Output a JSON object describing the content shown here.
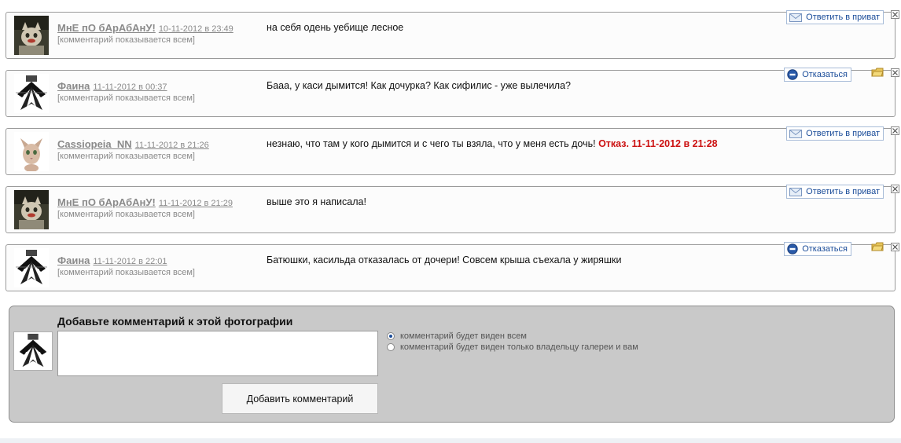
{
  "comments": [
    {
      "author": "МнЕ пО бАрАбАнУ!",
      "date": "10-11-2012 в 23:49",
      "visibility": "[комментарий показывается всем]",
      "text": "на себя одень уебище лесное",
      "refusal": "",
      "action": "Ответить в приват",
      "action_icon": "envelope-icon",
      "avatar": "cat-avatar"
    },
    {
      "author": "Фаина",
      "date": "11-11-2012 в 00:37",
      "visibility": "[комментарий показывается всем]",
      "text": "Бааа, у каси дымится! Как дочурка? Как сифилис - уже вылечила?",
      "refusal": "",
      "action": "Отказаться",
      "action_icon": "minus-circle-icon",
      "avatar": "bw-drawing-avatar"
    },
    {
      "author": "Cassiopeia_NN",
      "date": "11-11-2012 в 21:26",
      "visibility": "[комментарий показывается всем]",
      "text": "незнаю, что там у кого дымится и с чего ты взяла, что у меня есть дочь!",
      "refusal": "Отказ. 11-11-2012 в 21:28",
      "action": "Ответить в приват",
      "action_icon": "envelope-icon",
      "avatar": "sphynx-cat-avatar"
    },
    {
      "author": "МнЕ пО бАрАбАнУ!",
      "date": "11-11-2012 в 21:29",
      "visibility": "[комментарий показывается всем]",
      "text": "выше это я написала!",
      "refusal": "",
      "action": "Ответить в приват",
      "action_icon": "envelope-icon",
      "avatar": "cat-avatar"
    },
    {
      "author": "Фаина",
      "date": "11-11-2012 в 22:01",
      "visibility": "[комментарий показывается всем]",
      "text": "Батюшки, касильда отказалась от дочери! Совсем крыша съехала у жиряшки",
      "refusal": "",
      "action": "Отказаться",
      "action_icon": "minus-circle-icon",
      "avatar": "bw-drawing-avatar"
    }
  ],
  "add_comment": {
    "title": "Добавьте комментарий к этой фотографии",
    "options": [
      {
        "label": "комментарий будет виден всем",
        "selected": true
      },
      {
        "label": "комментарий будет виден только владельцу галереи и вам",
        "selected": false
      }
    ],
    "submit_label": "Добавить комментарий",
    "textarea_value": ""
  },
  "colors": {
    "link_blue": "#1a4c99",
    "refusal_red": "#cc1111",
    "author_gray": "#8a8a8a",
    "panel_gray": "#c9c9c9"
  }
}
